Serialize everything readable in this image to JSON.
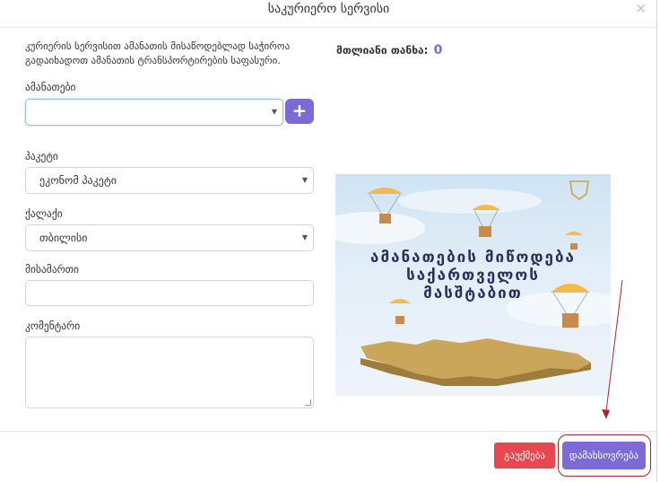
{
  "modal": {
    "title": "საკურიერო სერვისი",
    "close_label": "×"
  },
  "form": {
    "intro": "კურიერის სერვისით ამანათის მისაწოდებლად საჭიროა გადაიხადოთ ამანათის ტრანსპორტირების საფასური.",
    "parcels_label": "ამანათები",
    "parcels_value": "",
    "package_label": "პაკეტი",
    "package_value": "ეკონომ პაკეტი",
    "city_label": "ქალაქი",
    "city_value": "თბილისი",
    "address_label": "მისამართი",
    "address_value": "",
    "comment_label": "კომენტარი",
    "comment_value": "",
    "add_button_label": "+"
  },
  "summary": {
    "total_label": "მთლიანი თანხა:",
    "total_value": "0"
  },
  "banner": {
    "line1": "ამანათების მიწოდება",
    "line2": "საქართველოს",
    "line3": "მასშტაბით"
  },
  "footer": {
    "cancel_label": "გაუქმება",
    "save_label": "დამახსოვრება"
  },
  "colors": {
    "accent": "#7c6bd6",
    "danger": "#e8474f",
    "highlight": "#b3202a"
  }
}
